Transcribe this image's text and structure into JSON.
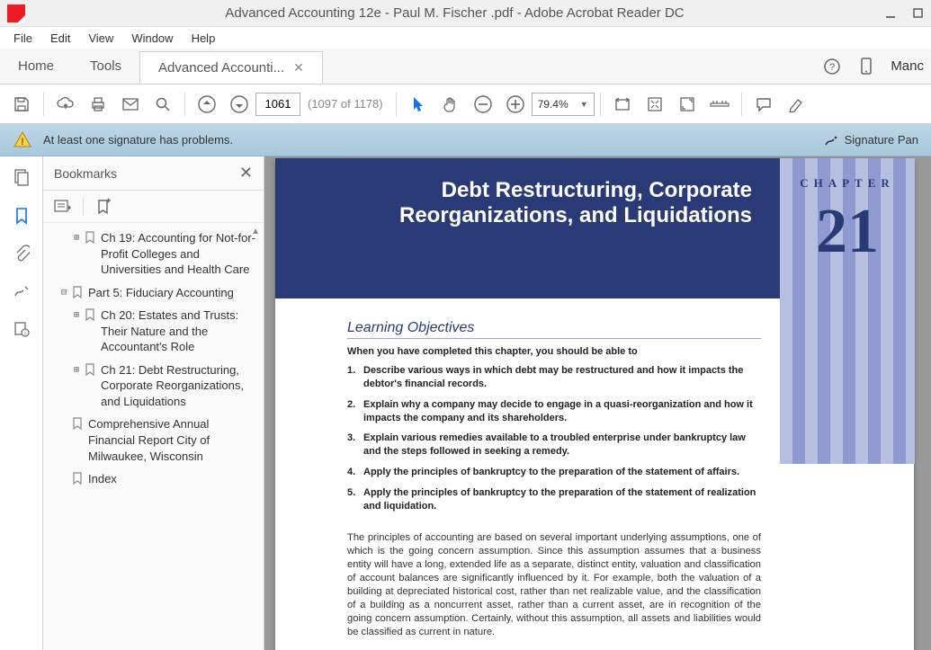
{
  "titlebar": {
    "title": "Advanced Accounting 12e - Paul M. Fischer .pdf - Adobe Acrobat Reader DC"
  },
  "menubar": {
    "file": "File",
    "edit": "Edit",
    "view": "View",
    "window": "Window",
    "help": "Help"
  },
  "tabsrow": {
    "home": "Home",
    "tools": "Tools",
    "doc_tab": "Advanced Accounti...",
    "signin": "Manc"
  },
  "toolbar": {
    "page_input": "1061",
    "page_count": "(1097 of 1178)",
    "zoom": "79.4%"
  },
  "banner": {
    "msg": "At least one signature has problems.",
    "sig_btn": "Signature Pan"
  },
  "bookmarks": {
    "title": "Bookmarks",
    "items": [
      {
        "indent": 2,
        "expander": "⊞",
        "label": "Ch 19: Accounting for Not-for-Profit Colleges and Universities and Health Care"
      },
      {
        "indent": 1,
        "expander": "⊟",
        "label": "Part 5: Fiduciary Accounting"
      },
      {
        "indent": 2,
        "expander": "⊞",
        "label": "Ch 20: Estates and Trusts: Their Nature and the Accountant's Role"
      },
      {
        "indent": 2,
        "expander": "⊞",
        "label": "Ch 21: Debt Restructuring, Corporate Reorganizations, and Liquidations"
      },
      {
        "indent": 1,
        "expander": "",
        "label": "Comprehensive Annual Financial Report City of Milwaukee, Wisconsin"
      },
      {
        "indent": 1,
        "expander": "",
        "label": "Index"
      }
    ]
  },
  "document": {
    "title_line1": "Debt Restructuring, Corporate",
    "title_line2": "Reorganizations, and Liquidations",
    "chapter_label": "CHAPTER",
    "chapter_num": "21",
    "lo_heading": "Learning Objectives",
    "lo_intro": "When you have completed this chapter, you should be able to",
    "objectives": [
      "Describe various ways in which debt may be restructured and how it impacts the debtor's financial records.",
      "Explain why a company may decide to engage in a quasi-reorganization and how it impacts the company and its shareholders.",
      "Explain various remedies available to a troubled enterprise under bankruptcy law and the steps followed in seeking a remedy.",
      "Apply the principles of bankruptcy to the preparation of the statement of affairs.",
      "Apply the principles of bankruptcy to the preparation of the statement of realization and liquidation."
    ],
    "body_para": "The principles of accounting are based on several important underlying assumptions, one of which is the going concern assumption. Since this assumption assumes that a business entity will have a long, extended life as a separate, distinct entity, valuation and classification of account balances are significantly influenced by it. For example, both the valuation of a building at depreciated historical cost, rather than net realizable value, and the classification of a building as a noncurrent asset, rather than a current asset, are in recognition of the going concern assumption. Certainly, without this assumption, all assets and liabilities would be classified as current in nature."
  }
}
